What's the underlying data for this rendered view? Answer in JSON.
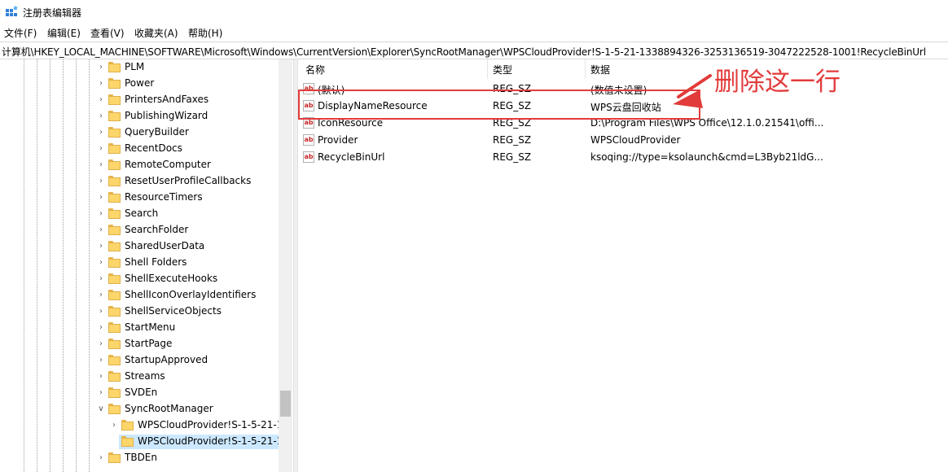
{
  "window": {
    "title": "注册表编辑器"
  },
  "menu": [
    {
      "label": "文件(F)"
    },
    {
      "label": "编辑(E)"
    },
    {
      "label": "查看(V)"
    },
    {
      "label": "收藏夹(A)"
    },
    {
      "label": "帮助(H)"
    }
  ],
  "address": {
    "path": "计算机\\HKEY_LOCAL_MACHINE\\SOFTWARE\\Microsoft\\Windows\\CurrentVersion\\Explorer\\SyncRootManager\\WPSCloudProvider!S-1-5-21-1338894326-3253136519-3047222528-1001!RecycleBinUrl"
  },
  "tree": {
    "items": [
      {
        "label": "PLM"
      },
      {
        "label": "Power"
      },
      {
        "label": "PrintersAndFaxes"
      },
      {
        "label": "PublishingWizard"
      },
      {
        "label": "QueryBuilder"
      },
      {
        "label": "RecentDocs"
      },
      {
        "label": "RemoteComputer"
      },
      {
        "label": "ResetUserProfileCallbacks"
      },
      {
        "label": "ResourceTimers"
      },
      {
        "label": "Search"
      },
      {
        "label": "SearchFolder"
      },
      {
        "label": "SharedUserData"
      },
      {
        "label": "Shell Folders"
      },
      {
        "label": "ShellExecuteHooks"
      },
      {
        "label": "ShellIconOverlayIdentifiers"
      },
      {
        "label": "ShellServiceObjects"
      },
      {
        "label": "StartMenu"
      },
      {
        "label": "StartPage"
      },
      {
        "label": "StartupApproved"
      },
      {
        "label": "Streams"
      },
      {
        "label": "SVDEn"
      },
      {
        "label": "SyncRootManager"
      },
      {
        "label": "WPSCloudProvider!S-1-5-21-1"
      },
      {
        "label": "WPSCloudProvider!S-1-5-21-1"
      },
      {
        "label": "TBDEn"
      }
    ]
  },
  "list": {
    "columns": {
      "name": "名称",
      "type": "类型",
      "data": "数据"
    },
    "rows": [
      {
        "name": "(默认)",
        "type": "REG_SZ",
        "data": "(数值未设置)"
      },
      {
        "name": "DisplayNameResource",
        "type": "REG_SZ",
        "data": "WPS云盘回收站"
      },
      {
        "name": "IconResource",
        "type": "REG_SZ",
        "data": "D:\\Program Files\\WPS Office\\12.1.0.21541\\offi..."
      },
      {
        "name": "Provider",
        "type": "REG_SZ",
        "data": "WPSCloudProvider"
      },
      {
        "name": "RecycleBinUrl",
        "type": "REG_SZ",
        "data": "ksoqing://type=ksolaunch&cmd=L3Byb21ldG..."
      }
    ]
  },
  "annotation": {
    "text": "删除这一行",
    "color": "#e23b3b"
  }
}
